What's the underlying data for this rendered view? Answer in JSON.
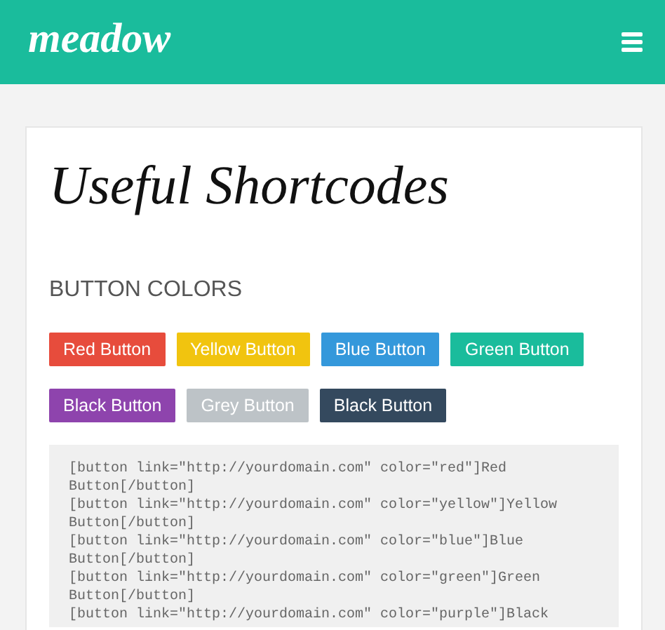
{
  "header": {
    "logo": "meadow"
  },
  "article": {
    "title": "Useful Shortcodes",
    "section_heading": "BUTTON COLORS",
    "button_rows": [
      [
        {
          "label": "Red Button",
          "color": "#e74c3c"
        },
        {
          "label": "Yellow Button",
          "color": "#f1c40f"
        },
        {
          "label": "Blue Button",
          "color": "#3498db"
        },
        {
          "label": "Green Button",
          "color": "#1abc9c"
        }
      ],
      [
        {
          "label": "Black Button",
          "color": "#8e44ad"
        },
        {
          "label": "Grey Button",
          "color": "#bdc3c7"
        },
        {
          "label": "Black Button",
          "color": "#34495e"
        }
      ]
    ],
    "code_lines": [
      "[button link=\"http://yourdomain.com\" color=\"red\"]Red",
      "Button[/button]",
      "[button link=\"http://yourdomain.com\" color=\"yellow\"]Yellow",
      "Button[/button]",
      "[button link=\"http://yourdomain.com\" color=\"blue\"]Blue",
      "Button[/button]",
      "[button link=\"http://yourdomain.com\" color=\"green\"]Green",
      "Button[/button]",
      "[button link=\"http://yourdomain.com\" color=\"purple\"]Black"
    ]
  }
}
